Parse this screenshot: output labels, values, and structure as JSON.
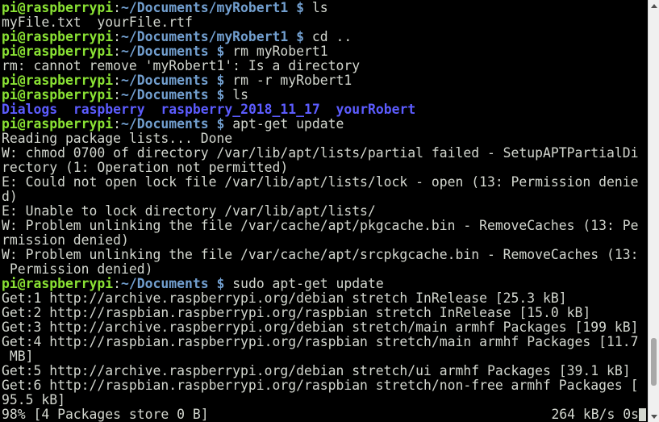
{
  "prompt": {
    "user_host": "pi@raspberrypi",
    "colon": ":",
    "dollar": "$"
  },
  "lines": [
    {
      "kind": "prompt",
      "path": "~/Documents/myRobert1",
      "cmd": "ls"
    },
    {
      "kind": "out",
      "text": "myFile.txt  yourFile.rtf"
    },
    {
      "kind": "prompt",
      "path": "~/Documents/myRobert1",
      "cmd": "cd .."
    },
    {
      "kind": "prompt",
      "path": "~/Documents",
      "cmd": "rm myRobert1"
    },
    {
      "kind": "out",
      "text": "rm: cannot remove 'myRobert1': Is a directory"
    },
    {
      "kind": "prompt",
      "path": "~/Documents",
      "cmd": "rm -r myRobert1"
    },
    {
      "kind": "prompt",
      "path": "~/Documents",
      "cmd": "ls"
    },
    {
      "kind": "dirs",
      "items": [
        "Dialogs",
        "raspberry",
        "raspberry_2018_11_17",
        "yourRobert"
      ]
    },
    {
      "kind": "prompt",
      "path": "~/Documents",
      "cmd": "apt-get update"
    },
    {
      "kind": "out",
      "text": "Reading package lists... Done"
    },
    {
      "kind": "out",
      "text": "W: chmod 0700 of directory /var/lib/apt/lists/partial failed - SetupAPTPartialDi"
    },
    {
      "kind": "out",
      "text": "rectory (1: Operation not permitted)"
    },
    {
      "kind": "out",
      "text": "E: Could not open lock file /var/lib/apt/lists/lock - open (13: Permission denie"
    },
    {
      "kind": "out",
      "text": "d)"
    },
    {
      "kind": "out",
      "text": "E: Unable to lock directory /var/lib/apt/lists/"
    },
    {
      "kind": "out",
      "text": "W: Problem unlinking the file /var/cache/apt/pkgcache.bin - RemoveCaches (13: Pe"
    },
    {
      "kind": "out",
      "text": "rmission denied)"
    },
    {
      "kind": "out",
      "text": "W: Problem unlinking the file /var/cache/apt/srcpkgcache.bin - RemoveCaches (13:"
    },
    {
      "kind": "out",
      "text": " Permission denied)"
    },
    {
      "kind": "prompt",
      "path": "~/Documents",
      "cmd": "sudo apt-get update"
    },
    {
      "kind": "out",
      "text": "Get:1 http://archive.raspberrypi.org/debian stretch InRelease [25.3 kB]"
    },
    {
      "kind": "out",
      "text": "Get:2 http://raspbian.raspberrypi.org/raspbian stretch InRelease [15.0 kB]"
    },
    {
      "kind": "out",
      "text": "Get:3 http://archive.raspberrypi.org/debian stretch/main armhf Packages [199 kB]"
    },
    {
      "kind": "out",
      "text": "Get:4 http://raspbian.raspberrypi.org/raspbian stretch/main armhf Packages [11.7"
    },
    {
      "kind": "out",
      "text": " MB]"
    },
    {
      "kind": "out",
      "text": "Get:5 http://archive.raspberrypi.org/debian stretch/ui armhf Packages [39.1 kB]"
    },
    {
      "kind": "out",
      "text": "Get:6 http://raspbian.raspberrypi.org/raspbian stretch/non-free armhf Packages ["
    },
    {
      "kind": "out",
      "text": "95.5 kB]"
    }
  ],
  "status": {
    "left": "98% [4 Packages store 0 B]",
    "right": "264 kB/s 0s"
  },
  "scrollbar": {
    "position_fraction": 0.93,
    "visible_fraction": 0.12
  },
  "colors": {
    "background": "#000000",
    "foreground": "#d3d7cf",
    "prompt_user": "#8ae234",
    "prompt_path": "#729fcf",
    "directory": "#5c5cff"
  }
}
